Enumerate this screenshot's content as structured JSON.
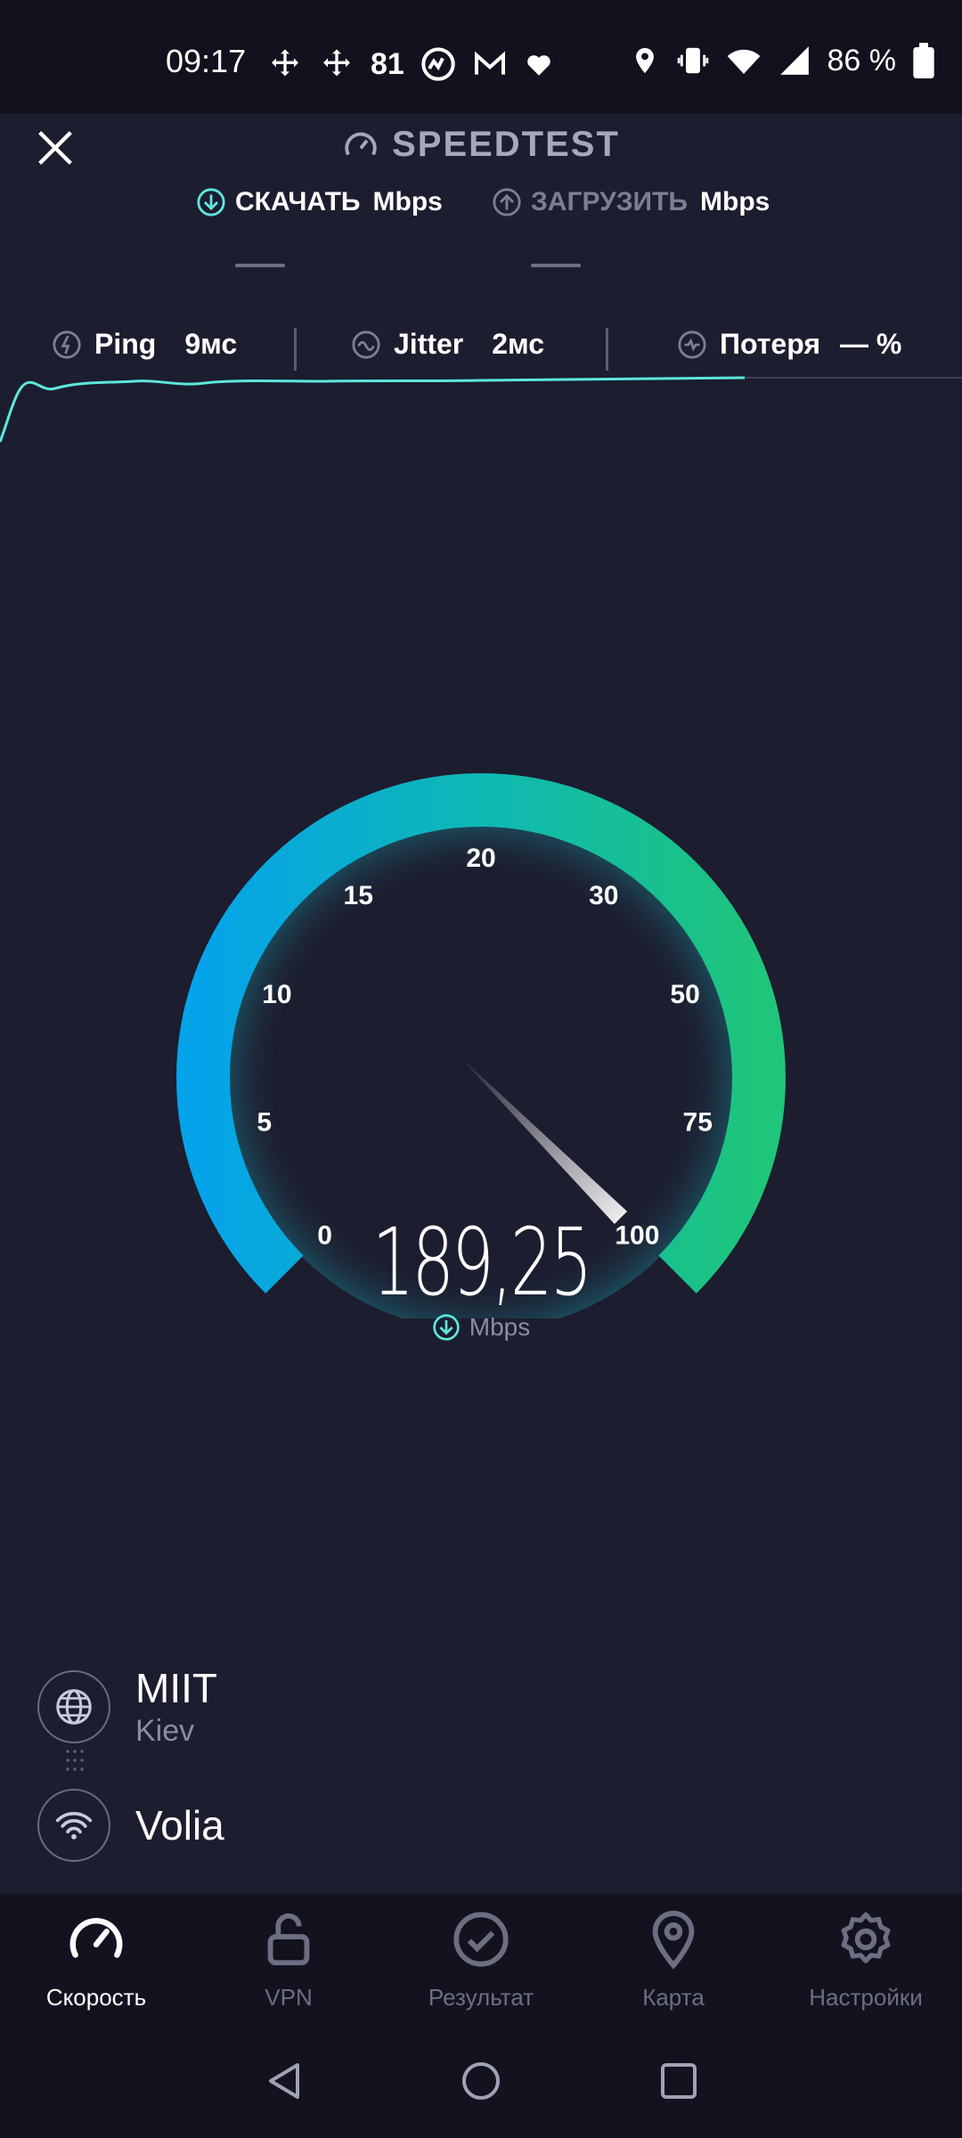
{
  "status_bar": {
    "time": "09:17",
    "notification_count": "81",
    "battery": "86 %"
  },
  "header": {
    "title": "SPEEDTEST"
  },
  "tabs": {
    "download_label": "СКАЧАТЬ",
    "download_unit": "Mbps",
    "upload_label": "ЗАГРУЗИТЬ",
    "upload_unit": "Mbps",
    "download_value": "—",
    "upload_value": "—"
  },
  "metrics": {
    "ping_label": "Ping",
    "ping_value": "9мс",
    "jitter_label": "Jitter",
    "jitter_value": "2мс",
    "loss_label": "Потеря",
    "loss_value": "— %"
  },
  "gauge": {
    "ticks": [
      "0",
      "5",
      "10",
      "15",
      "20",
      "30",
      "50",
      "75",
      "100"
    ],
    "speed_value": "189,25",
    "speed_unit": "Mbps",
    "needle_fraction": 1.0,
    "colors": {
      "start": "#05a3ea",
      "mid": "#0fb8b4",
      "end": "#1ec57a"
    }
  },
  "server": {
    "name": "MIIT",
    "city": "Kiev",
    "provider": "Volia"
  },
  "bottom_nav": {
    "items": [
      {
        "label": "Скорость",
        "icon": "speedometer-icon"
      },
      {
        "label": "VPN",
        "icon": "unlock-icon"
      },
      {
        "label": "Результат",
        "icon": "check-circle-icon"
      },
      {
        "label": "Карта",
        "icon": "map-pin-icon"
      },
      {
        "label": "Настройки",
        "icon": "gear-icon"
      }
    ]
  },
  "accent_color": "#5ee7df"
}
